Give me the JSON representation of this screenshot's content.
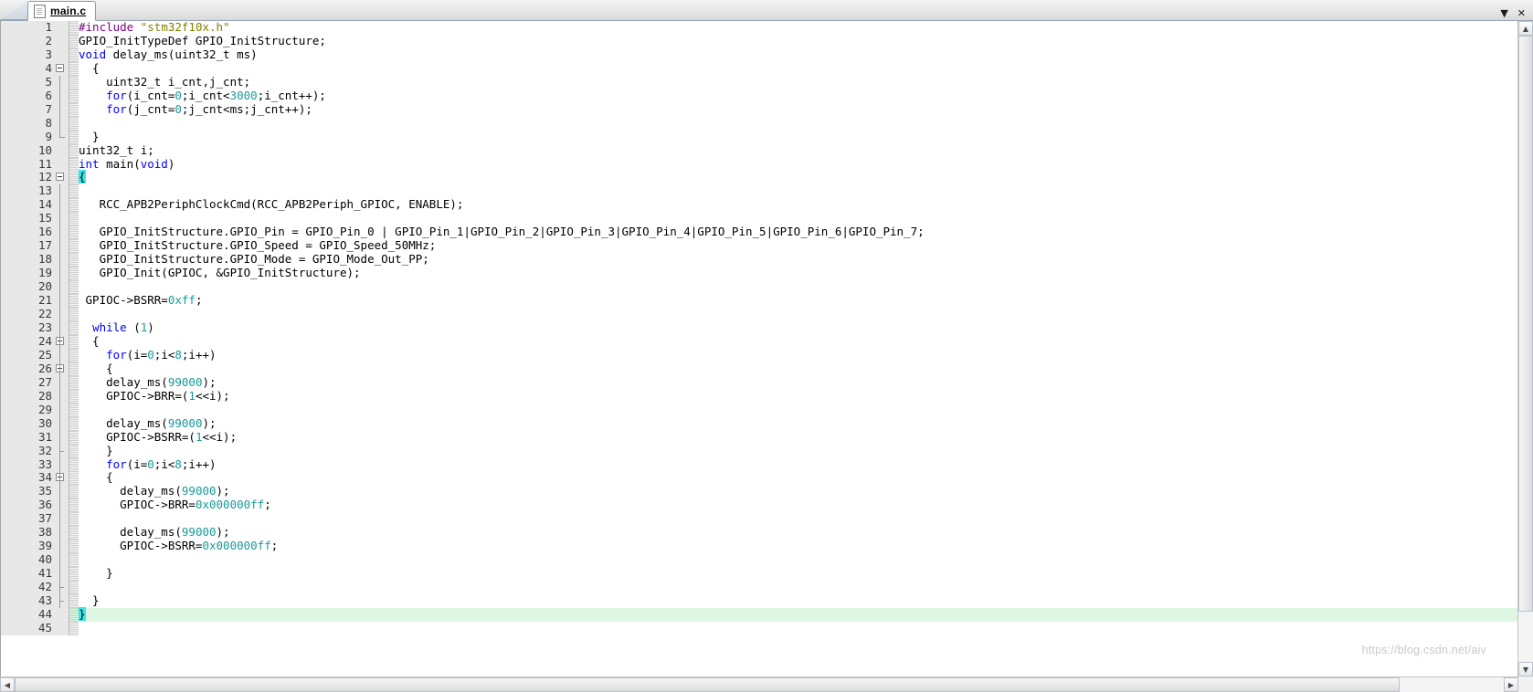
{
  "window": {
    "tab": {
      "label": "main.c",
      "icon": "document-icon"
    },
    "controls": {
      "minimize": "▼",
      "close": "✕"
    }
  },
  "editor": {
    "filename": "main.c",
    "current_line": 44,
    "total_visible_lines": 45,
    "colors": {
      "keyword": "#0000ff",
      "preprocessor": "#7f007f",
      "include_path": "#808000",
      "number": "#1a9a9a",
      "brace_match_highlight": "#39e6e6",
      "current_line_background": "#ddf7e3",
      "gutter_background": "#e8e8e8"
    },
    "lines": [
      {
        "n": 1,
        "fold": "none",
        "guide": "none",
        "text": "#include \"stm32f10x.h\""
      },
      {
        "n": 2,
        "fold": "none",
        "guide": "none",
        "text": "GPIO_InitTypeDef GPIO_InitStructure;"
      },
      {
        "n": 3,
        "fold": "none",
        "guide": "none",
        "text": "void delay_ms(uint32_t ms)"
      },
      {
        "n": 4,
        "fold": "minus",
        "guide": "none",
        "text": "  {"
      },
      {
        "n": 5,
        "fold": "none",
        "guide": "line",
        "text": "    uint32_t i_cnt,j_cnt;"
      },
      {
        "n": 6,
        "fold": "none",
        "guide": "line",
        "text": "    for(i_cnt=0;i_cnt<3000;i_cnt++);"
      },
      {
        "n": 7,
        "fold": "none",
        "guide": "line",
        "text": "    for(j_cnt=0;j_cnt<ms;j_cnt++);"
      },
      {
        "n": 8,
        "fold": "none",
        "guide": "line",
        "text": ""
      },
      {
        "n": 9,
        "fold": "end",
        "guide": "none",
        "text": "  }"
      },
      {
        "n": 10,
        "fold": "none",
        "guide": "none",
        "text": "uint32_t i;"
      },
      {
        "n": 11,
        "fold": "none",
        "guide": "none",
        "text": "int main(void)"
      },
      {
        "n": 12,
        "fold": "minus",
        "guide": "none",
        "text": "{"
      },
      {
        "n": 13,
        "fold": "none",
        "guide": "line",
        "text": ""
      },
      {
        "n": 14,
        "fold": "none",
        "guide": "line",
        "text": "   RCC_APB2PeriphClockCmd(RCC_APB2Periph_GPIOC, ENABLE);"
      },
      {
        "n": 15,
        "fold": "none",
        "guide": "line",
        "text": ""
      },
      {
        "n": 16,
        "fold": "none",
        "guide": "line",
        "text": "   GPIO_InitStructure.GPIO_Pin = GPIO_Pin_0 | GPIO_Pin_1|GPIO_Pin_2|GPIO_Pin_3|GPIO_Pin_4|GPIO_Pin_5|GPIO_Pin_6|GPIO_Pin_7;"
      },
      {
        "n": 17,
        "fold": "none",
        "guide": "line",
        "text": "   GPIO_InitStructure.GPIO_Speed = GPIO_Speed_50MHz;"
      },
      {
        "n": 18,
        "fold": "none",
        "guide": "line",
        "text": "   GPIO_InitStructure.GPIO_Mode = GPIO_Mode_Out_PP;"
      },
      {
        "n": 19,
        "fold": "none",
        "guide": "line",
        "text": "   GPIO_Init(GPIOC, &GPIO_InitStructure);"
      },
      {
        "n": 20,
        "fold": "none",
        "guide": "line",
        "text": ""
      },
      {
        "n": 21,
        "fold": "none",
        "guide": "line",
        "text": " GPIOC->BSRR=0xff;"
      },
      {
        "n": 22,
        "fold": "none",
        "guide": "line",
        "text": ""
      },
      {
        "n": 23,
        "fold": "none",
        "guide": "line",
        "text": "  while (1)"
      },
      {
        "n": 24,
        "fold": "minus",
        "guide": "line",
        "text": "  {"
      },
      {
        "n": 25,
        "fold": "none",
        "guide": "line2",
        "text": "    for(i=0;i<8;i++)"
      },
      {
        "n": 26,
        "fold": "minus",
        "guide": "line2",
        "text": "    {"
      },
      {
        "n": 27,
        "fold": "none",
        "guide": "line3",
        "text": "    delay_ms(99000);"
      },
      {
        "n": 28,
        "fold": "none",
        "guide": "line3",
        "text": "    GPIOC->BRR=(1<<i);"
      },
      {
        "n": 29,
        "fold": "none",
        "guide": "line3",
        "text": ""
      },
      {
        "n": 30,
        "fold": "none",
        "guide": "line3",
        "text": "    delay_ms(99000);"
      },
      {
        "n": 31,
        "fold": "none",
        "guide": "line3",
        "text": "    GPIOC->BSRR=(1<<i);"
      },
      {
        "n": 32,
        "fold": "tick",
        "guide": "line2",
        "text": "    }"
      },
      {
        "n": 33,
        "fold": "none",
        "guide": "line2",
        "text": "    for(i=0;i<8;i++)"
      },
      {
        "n": 34,
        "fold": "minus",
        "guide": "line2",
        "text": "    {"
      },
      {
        "n": 35,
        "fold": "none",
        "guide": "line3",
        "text": "      delay_ms(99000);"
      },
      {
        "n": 36,
        "fold": "none",
        "guide": "line3",
        "text": "      GPIOC->BRR=0x000000ff;"
      },
      {
        "n": 37,
        "fold": "none",
        "guide": "line3",
        "text": ""
      },
      {
        "n": 38,
        "fold": "none",
        "guide": "line3",
        "text": "      delay_ms(99000);"
      },
      {
        "n": 39,
        "fold": "none",
        "guide": "line3",
        "text": "      GPIOC->BSRR=0x000000ff;"
      },
      {
        "n": 40,
        "fold": "none",
        "guide": "line3",
        "text": ""
      },
      {
        "n": 41,
        "fold": "none",
        "guide": "line3",
        "text": "    }"
      },
      {
        "n": 42,
        "fold": "tick",
        "guide": "line2",
        "text": ""
      },
      {
        "n": 43,
        "fold": "tick",
        "guide": "line",
        "text": "  }"
      },
      {
        "n": 44,
        "fold": "none",
        "guide": "none",
        "text": "}"
      },
      {
        "n": 45,
        "fold": "none",
        "guide": "none",
        "text": ""
      }
    ]
  },
  "watermark": {
    "text": "https://blog.csdn.net/aiv"
  },
  "scrollbars": {
    "vertical": {
      "up": "▲",
      "down": "▼"
    },
    "horizontal": {
      "left": "◀",
      "right": "▶"
    }
  }
}
